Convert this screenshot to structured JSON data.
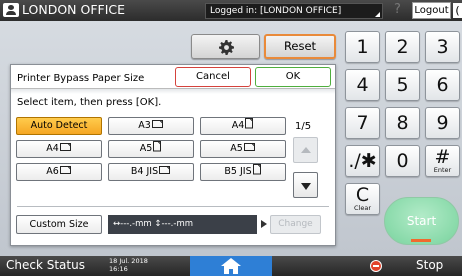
{
  "topbar": {
    "user_name": "LONDON OFFICE",
    "login_status": "Logged in: [LONDON OFFICE]",
    "help_icon": "question-icon",
    "logout_label": "Logout"
  },
  "controls": {
    "gear_icon": "gear-icon",
    "reset_label": "Reset"
  },
  "dialog": {
    "title": "Printer Bypass Paper Size",
    "cancel_label": "Cancel",
    "ok_label": "OK",
    "instruction": "Select item, then press [OK].",
    "options": [
      {
        "label": "Auto Detect",
        "orientation": "",
        "selected": true
      },
      {
        "label": "A3",
        "orientation": "landscape"
      },
      {
        "label": "A4",
        "orientation": "portrait"
      },
      {
        "label": "A4",
        "orientation": "landscape"
      },
      {
        "label": "A5",
        "orientation": "portrait"
      },
      {
        "label": "A5",
        "orientation": "landscape"
      },
      {
        "label": "A6",
        "orientation": "landscape"
      },
      {
        "label": "B4 JIS",
        "orientation": "landscape"
      },
      {
        "label": "B5 JIS",
        "orientation": "portrait"
      }
    ],
    "page_indicator": "1/5",
    "custom_size_label": "Custom Size",
    "custom_size_display": "↔---.-mm  ↕---.-mm",
    "change_label": "Change"
  },
  "keypad": {
    "keys": [
      {
        "label": "1",
        "sub": ""
      },
      {
        "label": "2",
        "sub": ""
      },
      {
        "label": "3",
        "sub": ""
      },
      {
        "label": "4",
        "sub": ""
      },
      {
        "label": "5",
        "sub": ""
      },
      {
        "label": "6",
        "sub": ""
      },
      {
        "label": "7",
        "sub": ""
      },
      {
        "label": "8",
        "sub": ""
      },
      {
        "label": "9",
        "sub": ""
      },
      {
        "label": "./✱",
        "sub": ""
      },
      {
        "label": "0",
        "sub": ""
      },
      {
        "label": "#",
        "sub": "Enter"
      },
      {
        "label": "C",
        "sub": "Clear"
      }
    ],
    "start_label": "Start"
  },
  "bottombar": {
    "check_status_label": "Check Status",
    "date": "18 Jul. 2018",
    "time": "16:16",
    "home_icon": "home-icon",
    "stop_label": "Stop"
  },
  "colors": {
    "selected": "#f5a623",
    "cancel_border": "#d4423c",
    "ok_border": "#4fae3e",
    "reset_border": "#e98a3a",
    "home": "#2e7fd6",
    "start": "#79d39e",
    "stop": "#e2432b"
  }
}
